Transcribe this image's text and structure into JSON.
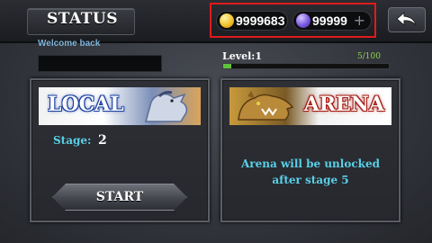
{
  "header": {
    "title": "STATUS",
    "gold": "9999683",
    "gems": "99999",
    "plus_symbol": "+",
    "back_icon": "back-arrow-icon"
  },
  "profile": {
    "welcome": "Welcome back",
    "name_value": "",
    "level_label": "Level:1",
    "xp_text": "5/100",
    "xp_progress": 0.05
  },
  "local": {
    "title": "LOCAL",
    "stage_label": "Stage:",
    "stage_value": "2",
    "start_label": "START"
  },
  "arena": {
    "title": "ARENA",
    "message_line1": "Arena will be unlocked",
    "message_line2": "after stage 5"
  },
  "colors": {
    "accent_text": "#5ad0e8",
    "xp_fill": "#5fc13a",
    "highlight": "#e01b1b"
  }
}
